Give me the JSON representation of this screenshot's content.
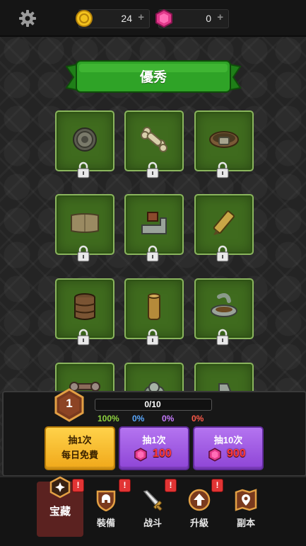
{
  "resources": {
    "coins": {
      "value": "24",
      "plus": "+",
      "icon": "gold-coin-icon"
    },
    "gems": {
      "value": "0",
      "plus": "+",
      "icon": "pink-gem-icon"
    }
  },
  "banner": {
    "title": "優秀"
  },
  "items": [
    {
      "icon": "round-shield-icon",
      "locked": true
    },
    {
      "icon": "bone-icon",
      "locked": true
    },
    {
      "icon": "belt-icon",
      "locked": true
    },
    {
      "icon": "leather-scroll-icon",
      "locked": true
    },
    {
      "icon": "boot-icon",
      "locked": true
    },
    {
      "icon": "whetstone-icon",
      "locked": true
    },
    {
      "icon": "barrel-icon",
      "locked": true
    },
    {
      "icon": "wooden-log-icon",
      "locked": true
    },
    {
      "icon": "stone-bowl-icon",
      "locked": true
    },
    {
      "icon": "dumbbell-icon",
      "locked": true
    },
    {
      "icon": "stone-pile-icon",
      "locked": true
    },
    {
      "icon": "stone-tooth-icon",
      "locked": true
    }
  ],
  "summon": {
    "level": "1",
    "progress_text": "0/10",
    "progress_fraction": 0,
    "rates": [
      {
        "text": "100%",
        "color": "#8fd43f"
      },
      {
        "text": "0%",
        "color": "#5aa8ff"
      },
      {
        "text": "0%",
        "color": "#c77bff"
      },
      {
        "text": "0%",
        "color": "#ff5a4a"
      }
    ],
    "buttons": {
      "free": {
        "line1": "抽1次",
        "line2": "每日免費"
      },
      "single": {
        "line1": "抽1次",
        "price": "100"
      },
      "ten": {
        "line1": "抽10次",
        "price": "900"
      }
    }
  },
  "nav": {
    "items": [
      {
        "label": "宝藏",
        "icon": "treasure-icon",
        "active": true,
        "alert": "!"
      },
      {
        "label": "裝備",
        "icon": "helmet-shield-icon",
        "active": false,
        "alert": "!"
      },
      {
        "label": "战斗",
        "icon": "sword-icon",
        "active": false,
        "alert": "!"
      },
      {
        "label": "升級",
        "icon": "upgrade-arrow-icon",
        "active": false,
        "alert": "!"
      },
      {
        "label": "副本",
        "icon": "map-pin-icon",
        "active": false,
        "alert": ""
      }
    ]
  },
  "colors": {
    "item_bg": "#3f6b1e",
    "item_border": "#8ab55d",
    "banner_green": "#2fa327",
    "yellow_button": "#f7be32",
    "purple_button": "#a25fe6",
    "active_tab": "#5b2220",
    "alert_red": "#e23434"
  }
}
